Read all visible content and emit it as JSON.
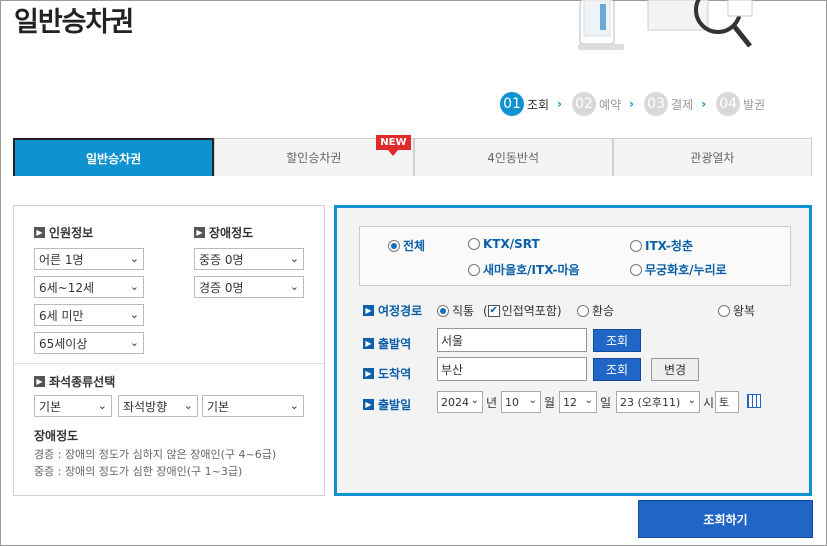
{
  "page_title": "일반승차권",
  "steps": [
    {
      "num": "01",
      "label": "조회"
    },
    {
      "num": "02",
      "label": "예약"
    },
    {
      "num": "03",
      "label": "결제"
    },
    {
      "num": "04",
      "label": "발권"
    }
  ],
  "tabs": [
    "일반승차권",
    "할인승차권",
    "4인동반석",
    "관광열차"
  ],
  "new_badge": "NEW",
  "passenger": {
    "title": "인원정보",
    "adult": "어른 1명",
    "child": "6세~12세",
    "infant": "6세 미만",
    "senior": "65세이상"
  },
  "disability": {
    "title": "장애정도",
    "severe": "중증 0명",
    "mild": "경증 0명"
  },
  "seat": {
    "title": "좌석종류선택",
    "type": "기본",
    "direction": "좌석방향",
    "extra": "기본"
  },
  "notes": {
    "title": "장애정도",
    "mild": "경증 : 장애의 정도가 심하지 않은 장애인(구 4~6급)",
    "severe": "중증 : 장애의 정도가 심한 장애인(구 1~3급)"
  },
  "train_types": {
    "all": "전체",
    "ktx": "KTX/SRT",
    "itx_cheongchun": "ITX-청춘",
    "saemaeul": "새마을호/ITX-마음",
    "mugunghwa": "무궁화호/누리로"
  },
  "route": {
    "label": "여정경로",
    "direct": "직통",
    "nearby": "인접역포함",
    "transfer": "환승",
    "round": "왕복"
  },
  "departure": {
    "label": "출발역",
    "value": "서울",
    "button": "조회"
  },
  "arrival": {
    "label": "도착역",
    "value": "부산",
    "button": "조회",
    "swap": "변경"
  },
  "date": {
    "label": "출발일",
    "year": "2024",
    "year_unit": "년",
    "month": "10",
    "month_unit": "월",
    "day": "12",
    "day_unit": "일",
    "hour": "23 (오후11)",
    "hour_unit": "시",
    "weekday": "토"
  },
  "search_button": "조회하기",
  "colors": {
    "accent": "#0e93d0",
    "button": "#1f66c7"
  }
}
